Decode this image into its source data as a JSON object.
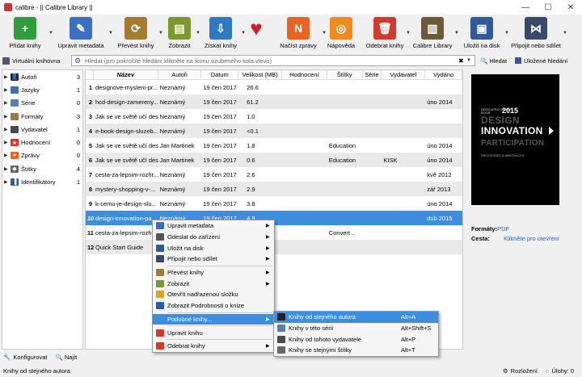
{
  "window": {
    "title": "calibre - || Calibre Library ||",
    "min": "—",
    "max": "☐",
    "close": "✕"
  },
  "toolbar": {
    "buttons": [
      {
        "label": "Přidat knihy",
        "icon": "add-book-icon",
        "color": "#2f9e3a",
        "glyph": "+",
        "menu": true
      },
      {
        "label": "Upravit metadata",
        "icon": "edit-metadata-icon",
        "color": "#3b6fc2",
        "glyph": "✎",
        "menu": true
      },
      {
        "label": "Převést knihy",
        "icon": "convert-books-icon",
        "color": "#a47a2e",
        "glyph": "⟳",
        "menu": true
      },
      {
        "label": "Zobrazit",
        "icon": "view-book-icon",
        "color": "#7a9a2e",
        "glyph": "▤",
        "menu": true
      },
      {
        "label": "Získat knihy",
        "icon": "get-books-icon",
        "color": "#2e7ac2",
        "glyph": "⇩",
        "menu": true
      },
      {
        "label": "",
        "icon": "heart-icon",
        "color": "#d41c2c",
        "glyph": "♥",
        "menu": false
      },
      {
        "label": "Načíst zprávy",
        "icon": "fetch-news-icon",
        "color": "#e96420",
        "glyph": "N",
        "menu": true
      },
      {
        "label": "Nápověda",
        "icon": "help-icon",
        "color": "#f08a1c",
        "glyph": "◎",
        "menu": false
      },
      {
        "label": "Odebrat knihy",
        "icon": "remove-books-icon",
        "color": "#d43a2c",
        "glyph": "🗑",
        "menu": true
      },
      {
        "label": "Calibre Library",
        "icon": "library-icon",
        "color": "#6a5a3a",
        "glyph": "▥",
        "menu": true
      },
      {
        "label": "Uložit na disk",
        "icon": "save-to-disk-icon",
        "color": "#2e5a9c",
        "glyph": "▣",
        "menu": true
      },
      {
        "label": "Připojit nebo sdílet",
        "icon": "connect-share-icon",
        "color": "#3a4a6a",
        "glyph": "⋈",
        "menu": true
      }
    ]
  },
  "search": {
    "virtual_library": "Virtuální knihovna",
    "placeholder": "Hledat (pro pokročilé hledání klikněte na ikonu ozubeného kola vlevo)",
    "search_button": "Hledat",
    "saved_search": "Uložené hledání"
  },
  "tags": [
    {
      "name": "Autoři",
      "count": "3",
      "icon": "author-icon",
      "color": "#222",
      "glyph": "👤"
    },
    {
      "name": "Jazyky",
      "count": "1",
      "icon": "language-icon",
      "color": "#3a6ec2",
      "glyph": ""
    },
    {
      "name": "Série",
      "count": "0",
      "icon": "series-icon",
      "color": "#5a7fb0",
      "glyph": ""
    },
    {
      "name": "Formáty",
      "count": "3",
      "icon": "formats-icon",
      "color": "#a0784a",
      "glyph": ""
    },
    {
      "name": "Vydavatel",
      "count": "1",
      "icon": "publisher-icon",
      "color": "#4a4a4a",
      "glyph": ""
    },
    {
      "name": "Hodnocení",
      "count": "0",
      "icon": "rating-icon",
      "color": "#e0302c",
      "glyph": "★"
    },
    {
      "name": "Zprávy",
      "count": "0",
      "icon": "news-icon",
      "color": "#e96420",
      "glyph": "●"
    },
    {
      "name": "Štítky",
      "count": "4",
      "icon": "tags-icon",
      "color": "#666",
      "glyph": "◆"
    },
    {
      "name": "Identifikátory",
      "count": "1",
      "icon": "identifiers-icon",
      "color": "#2a5ab0",
      "glyph": "▐"
    }
  ],
  "bottom_left": {
    "configure": "Konfigurovat",
    "find": "Najít"
  },
  "table": {
    "headers": [
      "",
      "Název",
      "Autoři",
      "Datum",
      "Velikost (MB)",
      "Hodnocení",
      "Štítky",
      "Série",
      "Vydavatel",
      "Vydáno"
    ],
    "rows": [
      [
        "1",
        "designove-mysleni-pr...",
        "Neznámý",
        "19 čen 2017",
        "26.6",
        "",
        "",
        "",
        "",
        ""
      ],
      [
        "2",
        "hcd-design-zamereny...",
        "Neznámý",
        "19 čen 2017",
        "61.2",
        "",
        "",
        "",
        "",
        "úno 2014"
      ],
      [
        "3",
        "Jak se ve světě učí des...",
        "Neznámý",
        "19 čen 2017",
        "1.0",
        "",
        "",
        "",
        "",
        ""
      ],
      [
        "4",
        "e-book-design-sluzeb...",
        "Neznámý",
        "19 čen 2017",
        "<0.1",
        "",
        "",
        "",
        "",
        ""
      ],
      [
        "5",
        "Jak se ve světě učí des...",
        "Jan Martinek",
        "19 čen 2017",
        "1.8",
        "",
        "Education",
        "",
        "",
        "úno 2014"
      ],
      [
        "6",
        "Jak se ve světě učí des...",
        "Jan Martinek",
        "19 čen 2017",
        "0.6",
        "",
        "Education",
        "",
        "KISK",
        "úno 2014"
      ],
      [
        "7",
        "cesta-za-lepsim-rozhr...",
        "Neznámý",
        "19 čen 2017",
        "2.6",
        "",
        "",
        "",
        "",
        "kvě 2012"
      ],
      [
        "8",
        "mystery-shopping-v-...",
        "Neznámý",
        "19 čen 2017",
        "2.9",
        "",
        "",
        "",
        "",
        "zář 2013"
      ],
      [
        "9",
        "k-cemu-je-design-slu...",
        "Neznámý",
        "19 čen 2017",
        "3.8",
        "",
        "",
        "",
        "",
        "úno 2014"
      ],
      [
        "10",
        "design-innovation-pa...",
        "Neznámý",
        "19 čen 2017",
        "4.9",
        "",
        "",
        "",
        "",
        "dub 2015"
      ],
      [
        "11",
        "cesta-za-lepsim-rozhr...",
        "",
        "",
        "",
        "",
        "Convert...",
        "",
        "",
        ""
      ],
      [
        "12",
        "Quick Start Guide",
        "",
        "",
        "",
        "",
        "",
        "",
        "",
        ""
      ]
    ],
    "selected_row": 9
  },
  "book_details": {
    "cover": {
      "small": "DEDICATED DESIGN BOOK",
      "year": "2015",
      "line1": "DESIGN",
      "line2": "INNOVATION",
      "line3": "PARTICIPATION",
      "sub": "PROCESSES & ABSTRACTS"
    },
    "formats_label": "Formáty:",
    "formats_value": "PDF",
    "path_label": "Cesta:",
    "path_value": "Klikněte pro otevření"
  },
  "context_menu": [
    {
      "label": "Upravit metadata",
      "icon": "edit-metadata-icon",
      "color": "#3b6fc2",
      "sub": true
    },
    {
      "label": "Odeslat do zařízení",
      "icon": "send-device-icon",
      "color": "#555",
      "sub": true
    },
    {
      "label": "Uložit na disk",
      "icon": "save-to-disk-icon",
      "color": "#2e5a9c",
      "sub": true
    },
    {
      "label": "Připojit nebo sdílet",
      "icon": "connect-share-icon",
      "color": "#3a4a6a",
      "sub": true
    },
    {
      "sep": true
    },
    {
      "label": "Převést knihy",
      "icon": "convert-books-icon",
      "color": "#a47a2e",
      "sub": true
    },
    {
      "label": "Zobrazit",
      "icon": "view-book-icon",
      "color": "#7a9a2e",
      "sub": true
    },
    {
      "label": "Otevřít nadřazenou složku",
      "icon": "folder-icon",
      "color": "#d9a520",
      "sub": false
    },
    {
      "label": "Zobrazit Podrobnosti o knize",
      "icon": "info-icon",
      "color": "#2a5ab0",
      "sub": false
    },
    {
      "sep": true
    },
    {
      "label": "Podobné knihy...",
      "icon": "",
      "color": "",
      "sub": true,
      "hl": true
    },
    {
      "sep": true
    },
    {
      "label": "Upravit knihu",
      "icon": "edit-book-icon",
      "color": "#d43a2c",
      "sub": false
    },
    {
      "sep": true
    },
    {
      "label": "Odebrat knihy",
      "icon": "remove-books-icon",
      "color": "#d43a2c",
      "sub": true
    }
  ],
  "similar_menu": [
    {
      "label": "Knihy od stejného autora",
      "shortcut": "Alt+A",
      "icon": "author-icon",
      "color": "#222",
      "hl": true
    },
    {
      "label": "Knihy v této sérii",
      "shortcut": "Alt+Shift+S",
      "icon": "series-icon",
      "color": "#5a7fb0",
      "hl": false
    },
    {
      "label": "Knihy od tohoto vydavatele",
      "shortcut": "Alt+P",
      "icon": "publisher-icon",
      "color": "#4a4a4a",
      "hl": false
    },
    {
      "label": "Knihy se stejnými štítky",
      "shortcut": "Alt+T",
      "icon": "tags-icon",
      "color": "#666",
      "hl": false
    }
  ],
  "status": {
    "left": "Knihy od stejného autora",
    "layout": "Rozložení",
    "jobs": "Úlohy: 0"
  }
}
